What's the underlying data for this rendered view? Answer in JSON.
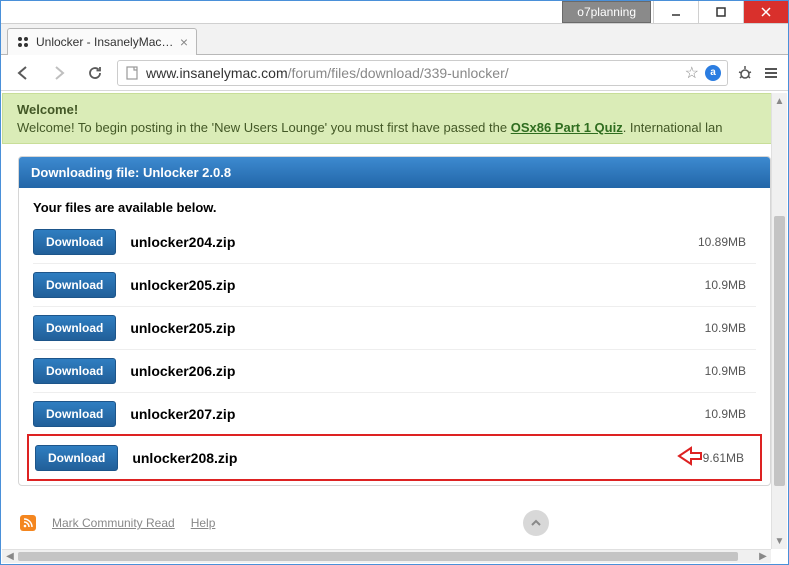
{
  "titlebar": {
    "user": "o7planning"
  },
  "tab": {
    "title": "Unlocker - InsanelyMac Fo"
  },
  "url": {
    "host": "www.insanelymac.com",
    "path": "/forum/files/download/339-unlocker/"
  },
  "welcome": {
    "title": "Welcome!",
    "pre": "Welcome! To begin posting in the 'New Users Lounge' you must first have passed the ",
    "link": "OSx86 Part 1 Quiz",
    "post": ". International lan"
  },
  "panel": {
    "header_prefix": "Downloading file: ",
    "header_file": "Unlocker 2.0.8",
    "available": "Your files are available below.",
    "download_label": "Download",
    "files": [
      {
        "name": "unlocker204.zip",
        "size": "10.89MB"
      },
      {
        "name": "unlocker205.zip",
        "size": "10.9MB"
      },
      {
        "name": "unlocker205.zip",
        "size": "10.9MB"
      },
      {
        "name": "unlocker206.zip",
        "size": "10.9MB"
      },
      {
        "name": "unlocker207.zip",
        "size": "10.9MB"
      },
      {
        "name": "unlocker208.zip",
        "size": "9.61MB"
      }
    ]
  },
  "footer": {
    "mark": "Mark Community Read",
    "help": "Help"
  }
}
